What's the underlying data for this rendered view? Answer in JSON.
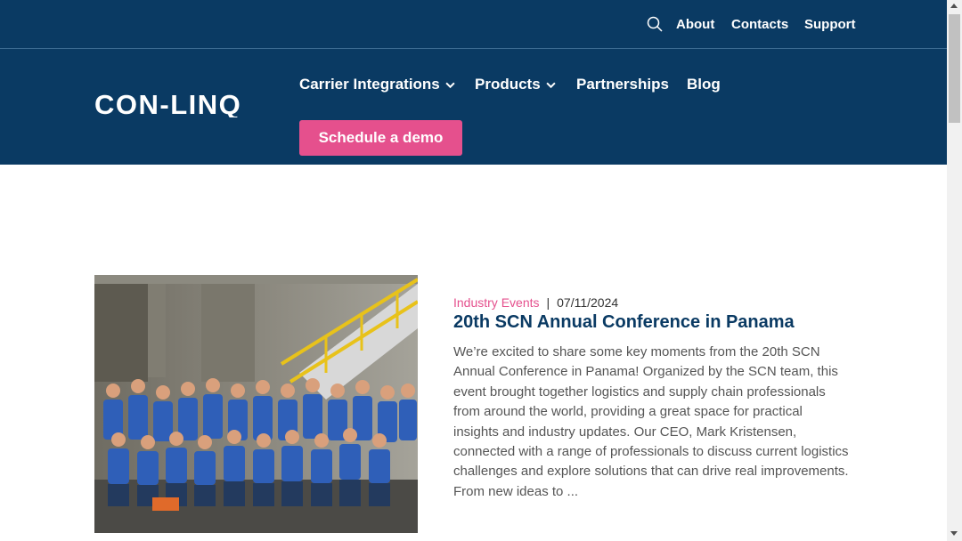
{
  "topbar": {
    "links": [
      "About",
      "Contacts",
      "Support"
    ]
  },
  "logo": {
    "text": "CON-LINQ"
  },
  "nav": {
    "items": [
      {
        "label": "Carrier Integrations",
        "dropdown": true
      },
      {
        "label": "Products",
        "dropdown": true
      },
      {
        "label": "Partnerships",
        "dropdown": false
      },
      {
        "label": "Blog",
        "dropdown": false
      }
    ],
    "cta": "Schedule a demo"
  },
  "post": {
    "category": "Industry Events",
    "date": "07/11/2024",
    "title": "20th SCN Annual Conference in Panama",
    "excerpt": "We’re excited to share some key moments from the 20th SCN Annual Conference in Panama! Organized by the SCN team, this event brought together logistics and supply chain professionals from around the world, providing a great space for practical insights and industry updates.  Our CEO, Mark Kristensen, connected with a range of professionals to discuss current logistics challenges and explore solutions that can drive real improvements. From new ideas to ..."
  },
  "colors": {
    "header_bg": "#0a3a63",
    "accent_pink": "#e5508d",
    "title_blue": "#0a3a63"
  }
}
